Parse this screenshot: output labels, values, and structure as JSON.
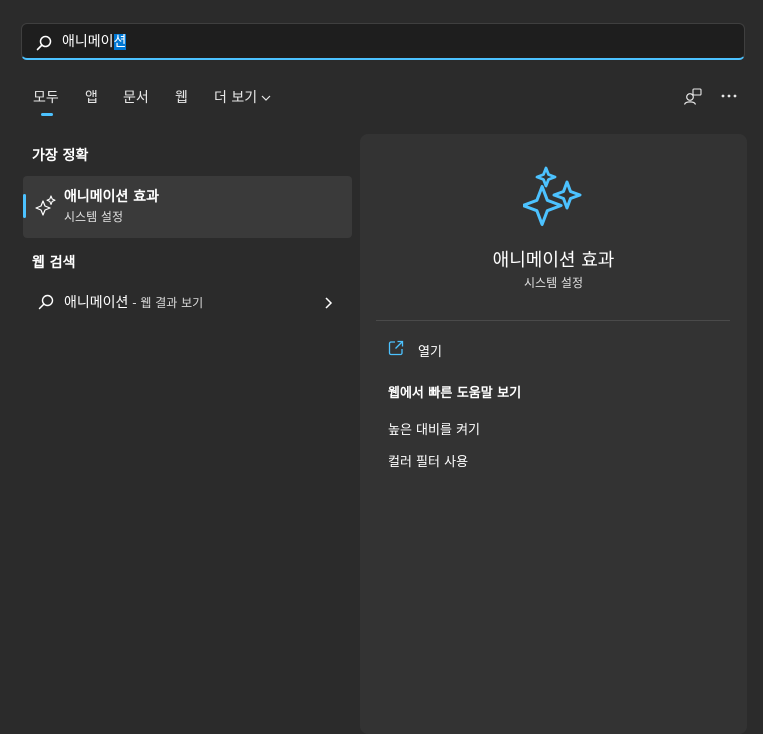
{
  "search": {
    "typed_prefix": "애니메이",
    "selected_suffix": "션"
  },
  "tabs": [
    {
      "label": "모두"
    },
    {
      "label": "앱"
    },
    {
      "label": "문서"
    },
    {
      "label": "웹"
    },
    {
      "label": "더 보기"
    }
  ],
  "sections": {
    "best_match_title": "가장 정확",
    "web_search_title": "웹 검색"
  },
  "best_match": {
    "title": "애니메이션 효과",
    "subtitle": "시스템 설정"
  },
  "web_result": {
    "query": "애니메이션",
    "suffix": " - 웹 결과 보기"
  },
  "preview": {
    "title": "애니메이션 효과",
    "subtitle": "시스템 설정",
    "open_label": "열기",
    "help_title": "웹에서 빠른 도움말 보기",
    "links": [
      "높은 대비를 켜기",
      "컬러 필터 사용"
    ]
  },
  "colors": {
    "accent": "#4cc2ff",
    "background": "#2b2b2b",
    "panel": "#333333"
  },
  "icons": {
    "search": "search-icon",
    "sparkle": "sparkle-icon",
    "open": "open-external-icon",
    "chevron_right": "chevron-right-icon",
    "chevron_down": "chevron-down-icon",
    "account": "account-switch-icon",
    "more": "more-options-icon"
  }
}
